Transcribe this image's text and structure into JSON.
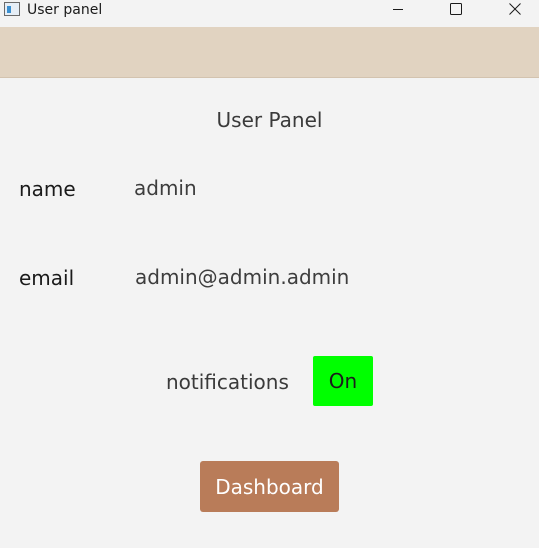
{
  "window": {
    "title": "User panel",
    "controls": {
      "minimize_icon": "minimize-icon",
      "maximize_icon": "maximize-icon",
      "close_icon": "close-icon"
    }
  },
  "panel": {
    "title": "User Panel"
  },
  "fields": {
    "name": {
      "label": "name",
      "value": "admin"
    },
    "email": {
      "label": "email",
      "value": "admin@admin.admin"
    }
  },
  "notifications": {
    "label": "notifications",
    "toggle_label": "On",
    "enabled": true
  },
  "actions": {
    "dashboard_label": "Dashboard"
  },
  "colors": {
    "header_band": "#e1d3c1",
    "toggle_on": "#00ff00",
    "dashboard_button": "#b97c59",
    "background": "#f3f3f3"
  }
}
